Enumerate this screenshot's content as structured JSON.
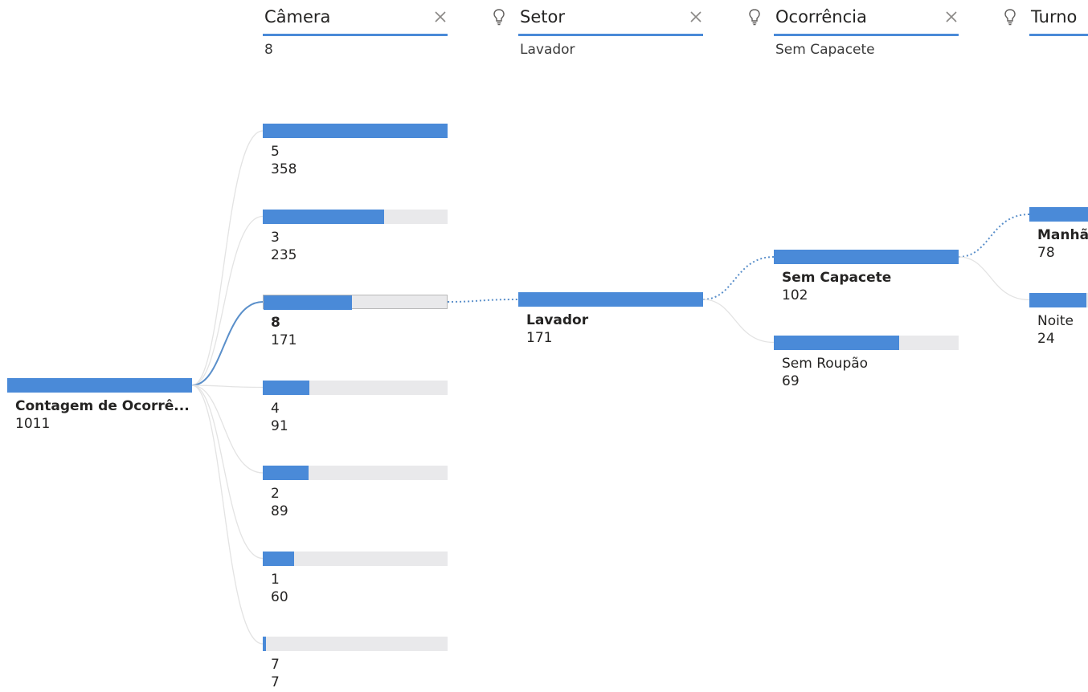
{
  "chart_data": {
    "type": "decomposition-tree",
    "root": {
      "label": "Contagem de Ocorrê...",
      "value": 1011
    },
    "levels": [
      {
        "title": "Câmera",
        "filter": "8",
        "has_close": true,
        "has_bulb": false,
        "nodes": [
          {
            "label": "5",
            "value": 358
          },
          {
            "label": "3",
            "value": 235
          },
          {
            "label": "8",
            "value": 171,
            "selected": true
          },
          {
            "label": "4",
            "value": 91
          },
          {
            "label": "2",
            "value": 89
          },
          {
            "label": "1",
            "value": 60
          },
          {
            "label": "7",
            "value": 7
          }
        ]
      },
      {
        "title": "Setor",
        "filter": "Lavador",
        "has_close": true,
        "has_bulb": true,
        "nodes": [
          {
            "label": "Lavador",
            "value": 171,
            "selected": true
          }
        ]
      },
      {
        "title": "Ocorrência",
        "filter": "Sem Capacete",
        "has_close": true,
        "has_bulb": true,
        "nodes": [
          {
            "label": "Sem Capacete",
            "value": 102,
            "selected": true
          },
          {
            "label": "Sem Roupão",
            "value": 69
          }
        ]
      },
      {
        "title": "Turno",
        "filter": "",
        "has_close": false,
        "has_bulb": true,
        "nodes": [
          {
            "label": "Manhã",
            "value": 78,
            "selected": true
          },
          {
            "label": "Noite",
            "value": 24
          }
        ]
      }
    ]
  },
  "colors": {
    "bar": "#4a8ad8",
    "track": "#e9e9eb",
    "active_link": "#5a8fca",
    "inactive_link": "#e3e3e3",
    "header_underline": "#4a8ad8"
  },
  "icons": {
    "remove": "close-icon",
    "ai_split": "lightbulb-icon"
  }
}
